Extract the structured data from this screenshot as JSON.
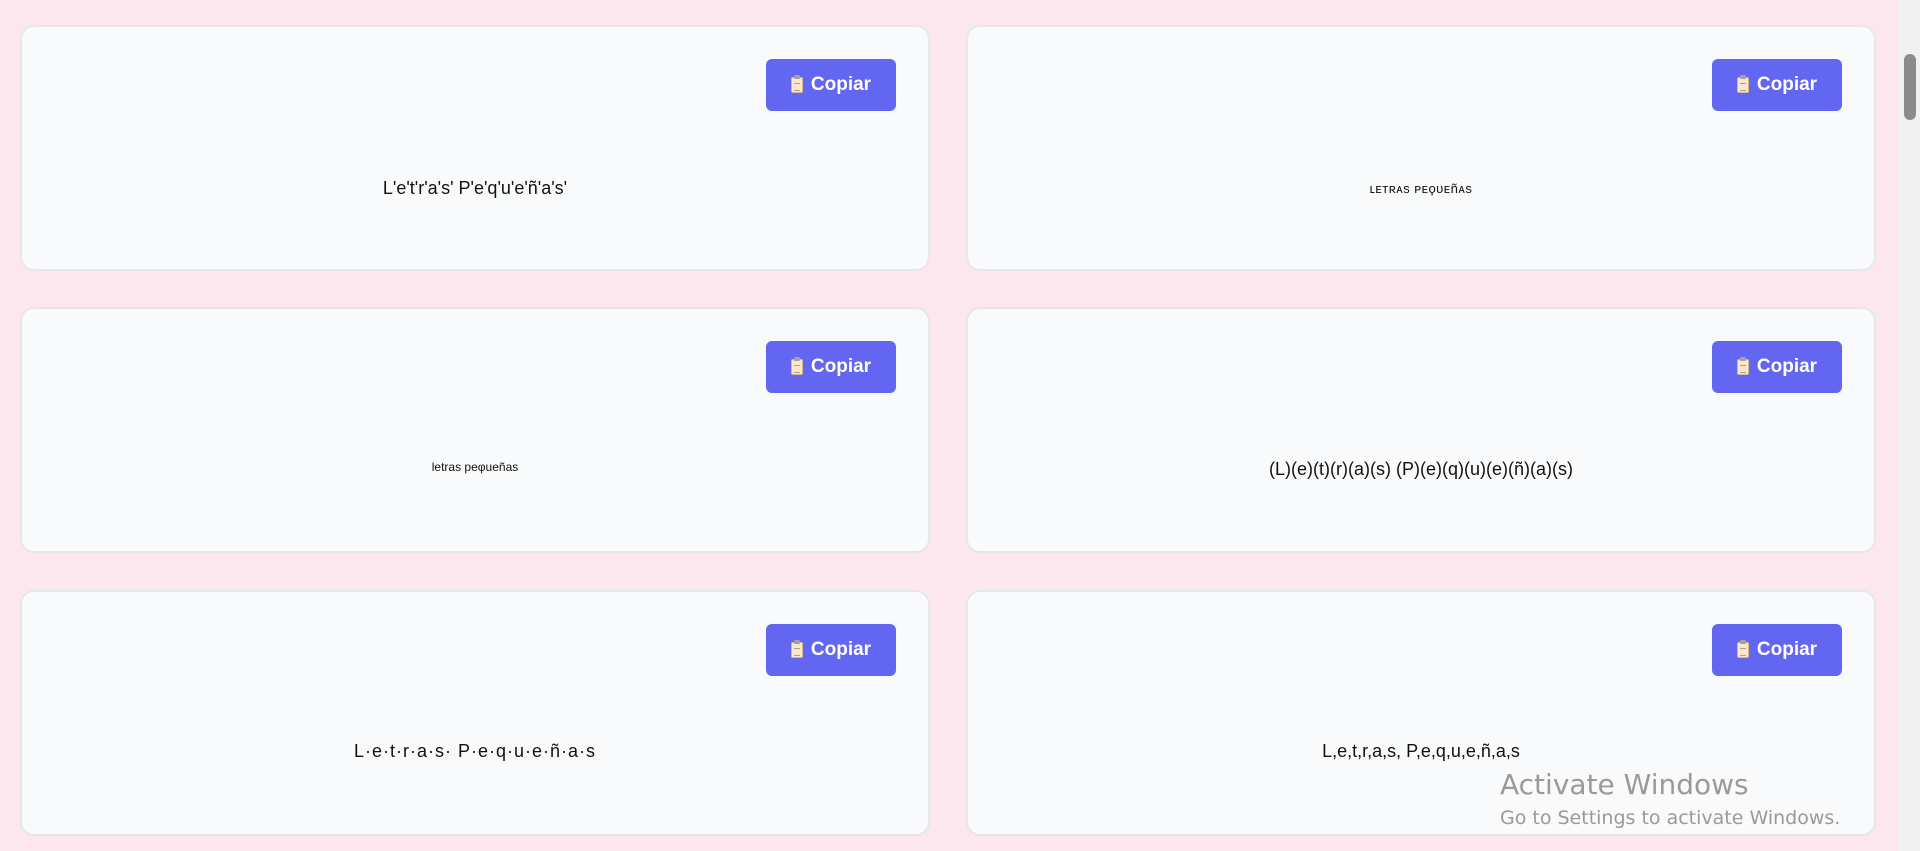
{
  "copy_button_label": "Copiar",
  "colors": {
    "page_background": "#fce7ee",
    "card_background": "#f8fafc",
    "button_background": "#6366f1",
    "button_text": "#ffffff"
  },
  "cards": [
    {
      "text": "L'e't'r'a's' P'e'q'u'e'ñ'a's'"
    },
    {
      "text": "ʟᴇᴛʀᴀs ᴘᴇϙᴜᴇñᴀs"
    },
    {
      "text": "letras peφueñas"
    },
    {
      "text": "(L)(e)(t)(r)(a)(s) (P)(e)(q)(u)(e)(ñ)(a)(s)"
    },
    {
      "text": "L·e·t·r·a·s· P·e·q·u·e·ñ·a·s"
    },
    {
      "text": "L,e,t,r,a,s, P,e,q,u,e,ñ,a,s"
    }
  ],
  "watermark": {
    "title": "Activate Windows",
    "subtitle": "Go to Settings to activate Windows."
  }
}
